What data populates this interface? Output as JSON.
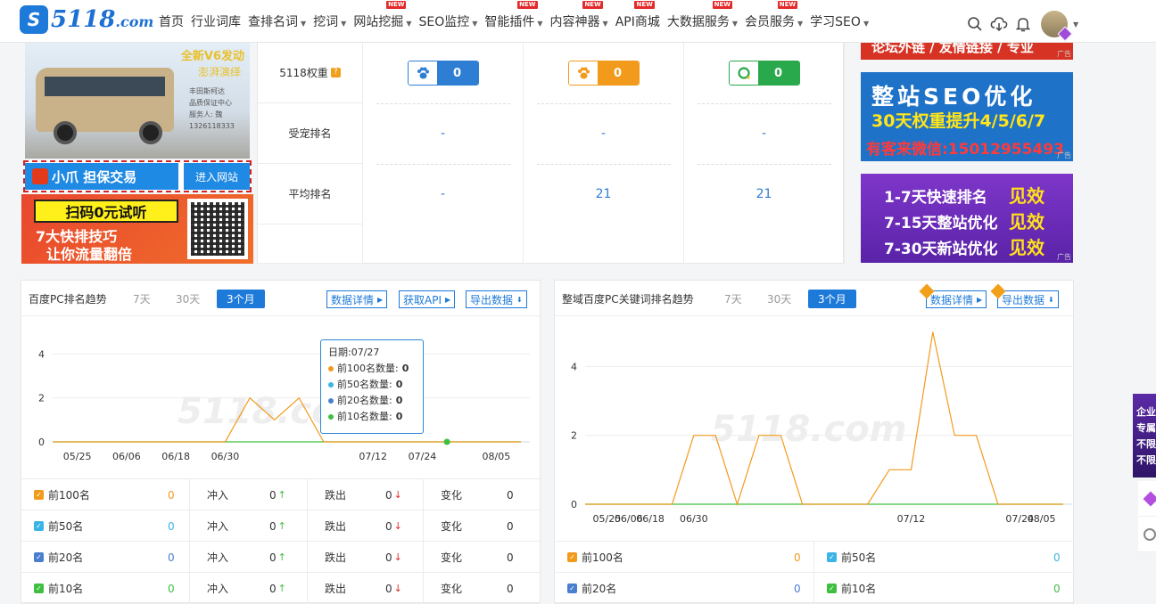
{
  "nav": {
    "logo_text": "5118",
    "logo_suffix": ".com",
    "items": [
      {
        "label": "首页",
        "dropdown": false,
        "new": false
      },
      {
        "label": "行业词库",
        "dropdown": false,
        "new": false
      },
      {
        "label": "查排名词",
        "dropdown": true,
        "new": false
      },
      {
        "label": "挖词",
        "dropdown": true,
        "new": false
      },
      {
        "label": "网站挖掘",
        "dropdown": true,
        "new": true
      },
      {
        "label": "SEO监控",
        "dropdown": true,
        "new": false
      },
      {
        "label": "智能插件",
        "dropdown": true,
        "new": true
      },
      {
        "label": "内容神器",
        "dropdown": true,
        "new": true
      },
      {
        "label": "API商城",
        "dropdown": false,
        "new": true
      },
      {
        "label": "大数据服务",
        "dropdown": true,
        "new": true
      },
      {
        "label": "会员服务",
        "dropdown": true,
        "new": true
      },
      {
        "label": "学习SEO",
        "dropdown": true,
        "new": false
      }
    ],
    "new_badge": "NEW",
    "icons": [
      "search-icon",
      "cloud-download-icon",
      "bell-icon"
    ]
  },
  "ads": {
    "bus_line1": "全新V6发动",
    "bus_line2": "澎湃演绎",
    "bus_line3": "丰田斯柯达\n品质保证中心\n服务人: 魏\n1326118333",
    "guarantee_label": "小爪 担保交易",
    "guarantee_button": "进入网站",
    "trial_title": "扫码0元试听",
    "trial_line1": "7大快排技巧",
    "trial_line2": "让你流量翻倍",
    "top_right_text": "论坛外链 / 友情链接 / 专业",
    "seo_line1": "整站SEO优化",
    "seo_line2": "30天权重提升4/5/6/7",
    "seo_line3": "有客来微信:15012955493",
    "rank_lines": [
      {
        "text": "1-7天快速排名",
        "tag": "见效"
      },
      {
        "text": "7-15天整站优化",
        "tag": "见效"
      },
      {
        "text": "7-30天新站优化",
        "tag": "见效"
      }
    ],
    "ad_mark": "广告",
    "float_ad_lines": [
      "企业",
      "专属",
      "不限",
      "不限"
    ]
  },
  "weight_table": {
    "rows": [
      {
        "label": "5118权重",
        "help": "?",
        "values": [
          "0",
          "0",
          "0"
        ]
      },
      {
        "label": "受宠排名",
        "values": [
          "-",
          "-",
          "-"
        ]
      },
      {
        "label": "平均排名",
        "values": [
          "-",
          "21",
          "21"
        ]
      }
    ],
    "engines": [
      {
        "icon": "baidu-paw-icon",
        "color": "#2e7ed3"
      },
      {
        "icon": "baidu-mobile-paw-icon",
        "color": "#f29a1c"
      },
      {
        "icon": "360-search-icon",
        "color": "#2aa84c"
      }
    ]
  },
  "left_panel": {
    "title": "百度PC排名趋势",
    "tabs": [
      "7天",
      "30天",
      "3个月"
    ],
    "active_tab": "3个月",
    "buttons": [
      "数据详情",
      "获取API",
      "导出数据"
    ],
    "watermark": "5118.com",
    "tooltip": {
      "date_label": "日期:07/27",
      "items": [
        {
          "label": "前100名数量:",
          "value": "0",
          "color": "#f29a1c"
        },
        {
          "label": "前50名数量:",
          "value": "0",
          "color": "#3ab4e6"
        },
        {
          "label": "前20名数量:",
          "value": "0",
          "color": "#4a7fd0"
        },
        {
          "label": "前10名数量:",
          "value": "0",
          "color": "#3fbf3f"
        }
      ]
    },
    "stats": [
      {
        "name": "前100名",
        "value": "0",
        "color": "#f29a1c",
        "up_label": "冲入",
        "up": "0",
        "down_label": "跌出",
        "down": "0",
        "change_label": "变化",
        "change": "0"
      },
      {
        "name": "前50名",
        "value": "0",
        "color": "#3ab4e6",
        "up_label": "冲入",
        "up": "0",
        "down_label": "跌出",
        "down": "0",
        "change_label": "变化",
        "change": "0"
      },
      {
        "name": "前20名",
        "value": "0",
        "color": "#4a7fd0",
        "up_label": "冲入",
        "up": "0",
        "down_label": "跌出",
        "down": "0",
        "change_label": "变化",
        "change": "0"
      },
      {
        "name": "前10名",
        "value": "0",
        "color": "#3fbf3f",
        "up_label": "冲入",
        "up": "0",
        "down_label": "跌出",
        "down": "0",
        "change_label": "变化",
        "change": "0"
      }
    ]
  },
  "right_panel": {
    "title": "整域百度PC关键词排名趋势",
    "tabs": [
      "7天",
      "30天",
      "3个月"
    ],
    "active_tab": "3个月",
    "buttons": [
      "数据详情",
      "导出数据"
    ],
    "watermark": "5118.com",
    "stats": [
      {
        "name": "前100名",
        "value": "0",
        "color": "#f29a1c"
      },
      {
        "name": "前50名",
        "value": "0",
        "color": "#3ab4e6"
      },
      {
        "name": "前20名",
        "value": "0",
        "color": "#4a7fd0"
      },
      {
        "name": "前10名",
        "value": "0",
        "color": "#3fbf3f"
      }
    ]
  },
  "chart_data": [
    {
      "type": "line",
      "title": "百度PC排名趋势",
      "x": [
        "05/19",
        "05/25",
        "06/01",
        "06/06",
        "06/12",
        "06/18",
        "06/24",
        "06/30",
        "07/02",
        "07/04",
        "07/06",
        "07/08",
        "07/10",
        "07/12",
        "07/18",
        "07/24",
        "07/27",
        "07/30",
        "08/05",
        "08/10"
      ],
      "x_ticks": [
        "05/25",
        "06/06",
        "06/18",
        "06/30",
        "07/12",
        "07/24",
        "08/05"
      ],
      "y_ticks": [
        0,
        2,
        4
      ],
      "ylim": [
        0,
        4.5
      ],
      "series": [
        {
          "name": "前100名",
          "color": "#f29a1c",
          "values": [
            0,
            0,
            0,
            0,
            0,
            0,
            0,
            0,
            2,
            1,
            2,
            0,
            0,
            0,
            0,
            0,
            0,
            0,
            0,
            0
          ]
        },
        {
          "name": "前10名",
          "color": "#3fbf3f",
          "values": [
            0,
            0,
            0,
            0,
            0,
            0,
            0,
            0,
            0,
            0,
            0,
            0,
            0,
            0,
            0,
            0,
            0,
            0,
            0,
            0
          ]
        }
      ]
    },
    {
      "type": "line",
      "title": "整域百度PC关键词排名趋势",
      "x": [
        "05/19",
        "05/25",
        "06/06",
        "06/18",
        "06/28",
        "06/30",
        "07/01",
        "07/02",
        "07/03",
        "07/04",
        "07/05",
        "07/06",
        "07/07",
        "07/10",
        "07/11",
        "07/12",
        "07/13",
        "07/14",
        "07/15",
        "07/16",
        "07/24",
        "08/05",
        "08/10"
      ],
      "x_ticks": [
        "05/25",
        "06/06",
        "06/18",
        "06/30",
        "07/12",
        "07/24",
        "08/05"
      ],
      "y_ticks": [
        0,
        2,
        4
      ],
      "ylim": [
        0,
        5.2
      ],
      "series": [
        {
          "name": "前100名",
          "color": "#f29a1c",
          "values": [
            0,
            0,
            0,
            0,
            0,
            2,
            2,
            0,
            2,
            2,
            0,
            0,
            0,
            0,
            1,
            1,
            5,
            2,
            2,
            0,
            0,
            0,
            0
          ]
        },
        {
          "name": "前10名",
          "color": "#3fbf3f",
          "values": [
            0,
            0,
            0,
            0,
            0,
            0,
            0,
            0,
            0,
            0,
            0,
            0,
            0,
            0,
            0,
            0,
            0,
            0,
            0,
            0,
            0,
            0,
            0
          ]
        }
      ]
    }
  ]
}
